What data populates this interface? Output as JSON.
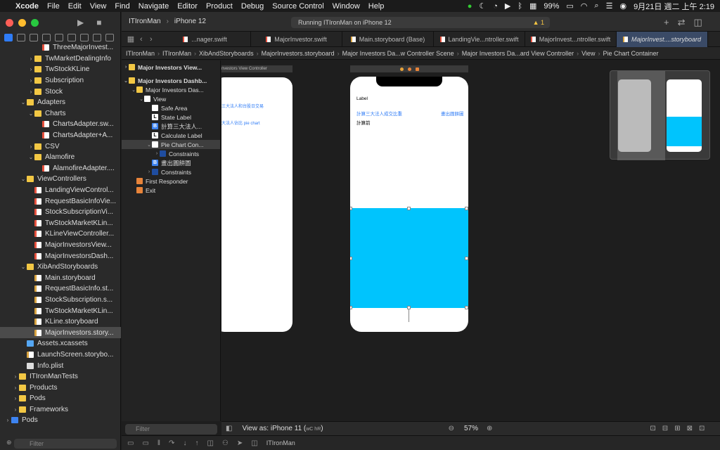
{
  "menubar": {
    "app": "Xcode",
    "items": [
      "File",
      "Edit",
      "View",
      "Find",
      "Navigate",
      "Editor",
      "Product",
      "Debug",
      "Source Control",
      "Window",
      "Help"
    ],
    "battery": "99%",
    "datetime": "9月21日 週二 上午 2:19"
  },
  "navigator": {
    "rows": [
      {
        "label": "ThreeMajorInvest...",
        "indent": 4,
        "icon": "swift",
        "chev": ""
      },
      {
        "label": "TwMarketDealingInfo",
        "indent": 3,
        "icon": "folder",
        "chev": "›"
      },
      {
        "label": "TwStockKLine",
        "indent": 3,
        "icon": "folder",
        "chev": "›"
      },
      {
        "label": "Subscription",
        "indent": 3,
        "icon": "folder",
        "chev": "›"
      },
      {
        "label": "Stock",
        "indent": 3,
        "icon": "folder",
        "chev": "›"
      },
      {
        "label": "Adapters",
        "indent": 2,
        "icon": "folder",
        "chev": "⌄"
      },
      {
        "label": "Charts",
        "indent": 3,
        "icon": "folder",
        "chev": "⌄"
      },
      {
        "label": "ChartsAdapter.sw...",
        "indent": 4,
        "icon": "swift",
        "chev": ""
      },
      {
        "label": "ChartsAdapter+A...",
        "indent": 4,
        "icon": "swift",
        "chev": ""
      },
      {
        "label": "CSV",
        "indent": 3,
        "icon": "folder",
        "chev": "›"
      },
      {
        "label": "Alamofire",
        "indent": 3,
        "icon": "folder",
        "chev": "⌄"
      },
      {
        "label": "AlamofireAdapter....",
        "indent": 4,
        "icon": "swift",
        "chev": ""
      },
      {
        "label": "ViewControllers",
        "indent": 2,
        "icon": "folder",
        "chev": "⌄"
      },
      {
        "label": "LandingViewControl...",
        "indent": 3,
        "icon": "swift",
        "chev": ""
      },
      {
        "label": "RequestBasicInfoVie...",
        "indent": 3,
        "icon": "swift",
        "chev": ""
      },
      {
        "label": "StockSubscriptionVi...",
        "indent": 3,
        "icon": "swift",
        "chev": ""
      },
      {
        "label": "TwStockMarketKLin...",
        "indent": 3,
        "icon": "swift",
        "chev": ""
      },
      {
        "label": "KLineViewController...",
        "indent": 3,
        "icon": "swift",
        "chev": ""
      },
      {
        "label": "MajorInvestorsView...",
        "indent": 3,
        "icon": "swift",
        "chev": ""
      },
      {
        "label": "MajorInvestorsDash...",
        "indent": 3,
        "icon": "swift",
        "chev": ""
      },
      {
        "label": "XibAndStoryboards",
        "indent": 2,
        "icon": "folder",
        "chev": "⌄"
      },
      {
        "label": "Main.storyboard",
        "indent": 3,
        "icon": "sb",
        "chev": ""
      },
      {
        "label": "RequestBasicInfo.st...",
        "indent": 3,
        "icon": "sb",
        "chev": ""
      },
      {
        "label": "StockSubscription.s...",
        "indent": 3,
        "icon": "sb",
        "chev": ""
      },
      {
        "label": "TwStockMarketKLin...",
        "indent": 3,
        "icon": "sb",
        "chev": ""
      },
      {
        "label": "KLine.storyboard",
        "indent": 3,
        "icon": "sb",
        "chev": ""
      },
      {
        "label": "MajorInvestors.story...",
        "indent": 3,
        "icon": "sb",
        "chev": "",
        "selected": true
      },
      {
        "label": "Assets.xcassets",
        "indent": 2,
        "icon": "asset",
        "chev": ""
      },
      {
        "label": "LaunchScreen.storybo...",
        "indent": 2,
        "icon": "sb",
        "chev": ""
      },
      {
        "label": "Info.plist",
        "indent": 2,
        "icon": "plist",
        "chev": ""
      },
      {
        "label": "ITIronManTests",
        "indent": 1,
        "icon": "folder",
        "chev": "›"
      },
      {
        "label": "Products",
        "indent": 1,
        "icon": "folder",
        "chev": "›"
      },
      {
        "label": "Pods",
        "indent": 1,
        "icon": "folder",
        "chev": "›"
      },
      {
        "label": "Frameworks",
        "indent": 1,
        "icon": "folder",
        "chev": "›"
      },
      {
        "label": "Pods",
        "indent": 0,
        "icon": "blue",
        "chev": "›"
      }
    ],
    "filter_placeholder": "Filter"
  },
  "toolbar": {
    "scheme": "ITIronMan",
    "device": "iPhone 12",
    "status": "Running ITIronMan on iPhone 12",
    "warnings": "1"
  },
  "tabs": [
    {
      "label": "...nager.swift",
      "type": "swift"
    },
    {
      "label": "MajorInvestor.swift",
      "type": "swift"
    },
    {
      "label": "Main.storyboard (Base)",
      "type": "sb"
    },
    {
      "label": "LandingVie...ntroller.swift",
      "type": "swift"
    },
    {
      "label": "MajorInvest...ntroller.swift",
      "type": "swift"
    },
    {
      "label": "MajorInvest....storyboard",
      "type": "sb",
      "active": true
    }
  ],
  "jumpbar": [
    "ITIronMan",
    "ITIronMan",
    "XibAndStoryboards",
    "MajorInvestors.storyboard",
    "Major Investors Da...w Controller Scene",
    "Major Investors Da...ard View Controller",
    "View",
    "Pie Chart Container"
  ],
  "outline": {
    "rows": [
      {
        "label": "Major Investors View...",
        "indent": 0,
        "chev": "›",
        "icon": "yl",
        "glyph": "",
        "bold": true
      },
      {
        "label": "Major Investors Dashb...",
        "indent": 0,
        "chev": "⌄",
        "icon": "yl",
        "glyph": "",
        "bold": true
      },
      {
        "label": "Major Investors Das...",
        "indent": 1,
        "chev": "⌄",
        "icon": "yl",
        "glyph": ""
      },
      {
        "label": "View",
        "indent": 2,
        "chev": "⌄",
        "icon": "wh",
        "glyph": ""
      },
      {
        "label": "Safe Area",
        "indent": 3,
        "chev": "",
        "icon": "wh",
        "glyph": ""
      },
      {
        "label": "State Label",
        "indent": 3,
        "chev": "",
        "icon": "lb",
        "glyph": "L"
      },
      {
        "label": "計算三大法人...",
        "indent": 3,
        "chev": "",
        "icon": "bl",
        "glyph": "B"
      },
      {
        "label": "Calculate Label",
        "indent": 3,
        "chev": "",
        "icon": "lb",
        "glyph": "L"
      },
      {
        "label": "Pie Chart Con...",
        "indent": 3,
        "chev": "⌄",
        "icon": "wh",
        "glyph": "",
        "hl": true
      },
      {
        "label": "Constraints",
        "indent": 4,
        "chev": "›",
        "icon": "cn",
        "glyph": ""
      },
      {
        "label": "畫出圓餅圖",
        "indent": 3,
        "chev": "",
        "icon": "bl",
        "glyph": "B"
      },
      {
        "label": "Constraints",
        "indent": 3,
        "chev": "›",
        "icon": "cn",
        "glyph": ""
      },
      {
        "label": "First Responder",
        "indent": 1,
        "chev": "",
        "icon": "or",
        "glyph": ""
      },
      {
        "label": "Exit",
        "indent": 1,
        "chev": "",
        "icon": "or",
        "glyph": ""
      }
    ],
    "filter_placeholder": "Filter"
  },
  "scene_a": {
    "title": "nvestors View Controller",
    "line1": "三大法人和台股日交易",
    "line2": "大法人佔比 pie chart"
  },
  "scene_b": {
    "label": "Label",
    "calc_button": "計算三大法人成交比重",
    "draw_button": "畫出圓餅圖",
    "calc_state": "計算前",
    "pie_color": "#00c4fd"
  },
  "bottom": {
    "view_as": "View as: iPhone 11 (",
    "view_as_keys": "wC hR",
    "view_as_end": ")",
    "zoom": "57%"
  },
  "debug": {
    "target": "ITIronMan"
  },
  "colors": {
    "accent": "#2f7cf6",
    "pie": "#00c4fd"
  }
}
